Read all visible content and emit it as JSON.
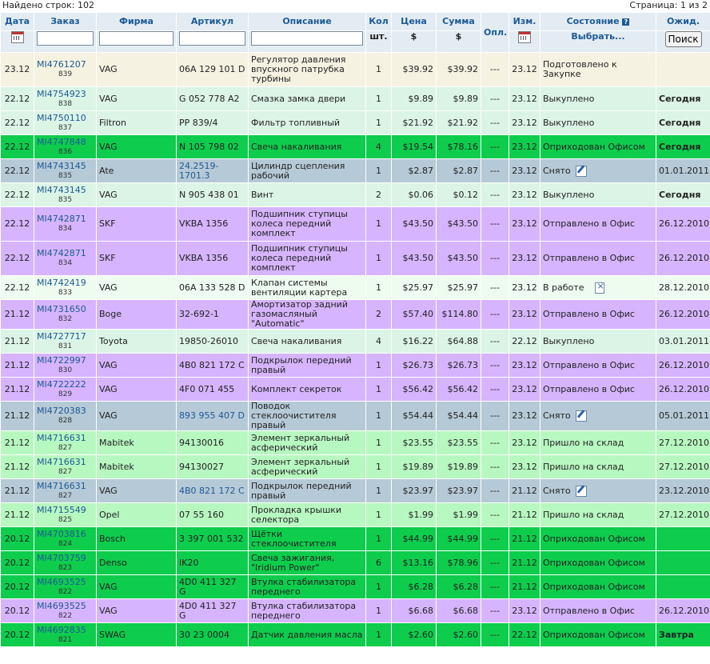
{
  "top": {
    "found": "Найдено строк: 102",
    "page": "Страница: 1 из 2"
  },
  "headers": {
    "date": "Дата",
    "order": "Заказ",
    "firm": "Фирма",
    "article": "Артикул",
    "desc": "Описание",
    "qty": "Кол",
    "qty_unit": "шт.",
    "price": "Цена",
    "price_unit": "$",
    "sum": "Сумма",
    "sum_unit": "$",
    "paid": "Опл.",
    "changed": "Изм.",
    "state": "Состояние",
    "state_select": "Выбрать...",
    "expected": "Ожид.",
    "search_btn": "Поиск"
  },
  "rows": [
    {
      "bg": "cream",
      "tall": true,
      "date": "23.12",
      "order": "MI4761207",
      "num": "839",
      "firm": "VAG",
      "article": "06A 129 101 D",
      "desc": "Регулятор давления впускного патрубка турбины",
      "qty": "1",
      "price": "$39.92",
      "sum": "$39.92",
      "paid": "---",
      "chg": "23.12",
      "state": "Подготовлено к Закупке",
      "icon": "",
      "exp": "",
      "expBold": false
    },
    {
      "bg": "mint",
      "date": "22.12",
      "order": "MI4754923",
      "num": "838",
      "firm": "VAG",
      "article": "G 052 778 A2",
      "desc": "Смазка замка двери",
      "qty": "1",
      "price": "$9.89",
      "sum": "$9.89",
      "paid": "---",
      "chg": "23.12",
      "state": "Выкуплено",
      "icon": "",
      "exp": "Сегодня",
      "expBold": true
    },
    {
      "bg": "mint",
      "date": "22.12",
      "order": "MI4750110",
      "num": "837",
      "firm": "Filtron",
      "article": "PP 839/4",
      "desc": "Фильтр топливный",
      "qty": "1",
      "price": "$21.92",
      "sum": "$21.92",
      "paid": "---",
      "chg": "23.12",
      "state": "Выкуплено",
      "icon": "",
      "exp": "Сегодня",
      "expBold": true
    },
    {
      "bg": "green",
      "date": "22.12",
      "order": "MI4747848",
      "num": "836",
      "firm": "VAG",
      "article": "N 105 798 02",
      "desc": "Свеча накаливания",
      "qty": "4",
      "price": "$19.54",
      "sum": "$78.16",
      "paid": "---",
      "chg": "23.12",
      "state": "Оприходован Офисом",
      "icon": "",
      "exp": "Сегодня",
      "expBold": true
    },
    {
      "bg": "grey",
      "date": "22.12",
      "order": "MI4743145",
      "num": "835",
      "firm": "Ate",
      "article": "24.2519-1701.3",
      "artlink": true,
      "desc": "Цилиндр сцепления рабочий",
      "qty": "1",
      "price": "$2.87",
      "sum": "$2.87",
      "paid": "---",
      "chg": "23.12",
      "state": "Снято",
      "icon": "edit",
      "exp": "01.01.2011",
      "expBold": false
    },
    {
      "bg": "mint",
      "date": "22.12",
      "order": "MI4743145",
      "num": "835",
      "firm": "VAG",
      "article": "N 905 438 01",
      "desc": "Винт",
      "qty": "2",
      "price": "$0.06",
      "sum": "$0.12",
      "paid": "---",
      "chg": "23.12",
      "state": "Выкуплено",
      "icon": "",
      "exp": "Сегодня",
      "expBold": true
    },
    {
      "bg": "purple",
      "tall": true,
      "date": "22.12",
      "order": "MI4742871",
      "num": "834",
      "firm": "SKF",
      "article": "VKBA 1356",
      "desc": "Подшипник ступицы колеса передний комплект",
      "qty": "1",
      "price": "$43.50",
      "sum": "$43.50",
      "paid": "---",
      "chg": "23.12",
      "state": "Отправлено в Офис",
      "icon": "",
      "exp": "26.12.2010",
      "expBold": false
    },
    {
      "bg": "purple",
      "tall": true,
      "date": "22.12",
      "order": "MI4742871",
      "num": "834",
      "firm": "SKF",
      "article": "VKBA 1356",
      "desc": "Подшипник ступицы колеса передний комплект",
      "qty": "1",
      "price": "$43.50",
      "sum": "$43.50",
      "paid": "---",
      "chg": "23.12",
      "state": "Отправлено в Офис",
      "icon": "",
      "exp": "26.12.2010",
      "expBold": false
    },
    {
      "bg": "light",
      "date": "22.12",
      "order": "MI4742419",
      "num": "833",
      "firm": "VAG",
      "article": "06A 133 528 D",
      "desc": "Клапан системы вентиляции картера",
      "qty": "1",
      "price": "$25.97",
      "sum": "$25.97",
      "paid": "---",
      "chg": "23.12",
      "state": "В работе",
      "icon": "del",
      "exp": "28.12.2010",
      "expBold": false
    },
    {
      "bg": "purple",
      "date": "21.12",
      "order": "MI4731650",
      "num": "832",
      "firm": "Boge",
      "article": "32-692-1",
      "desc": "Амортизатор задний газомасляный \"Automatic\"",
      "qty": "2",
      "price": "$57.40",
      "sum": "$114.80",
      "paid": "---",
      "chg": "23.12",
      "state": "Отправлено в Офис",
      "icon": "",
      "exp": "26.12.2010",
      "expBold": false
    },
    {
      "bg": "mint",
      "date": "21.12",
      "order": "MI4727717",
      "num": "831",
      "firm": "Toyota",
      "article": "19850-26010",
      "desc": "Свеча накаливания",
      "qty": "4",
      "price": "$16.22",
      "sum": "$64.88",
      "paid": "---",
      "chg": "22.12",
      "state": "Выкуплено",
      "icon": "",
      "exp": "03.01.2011",
      "expBold": false
    },
    {
      "bg": "purple",
      "date": "21.12",
      "order": "MI4722997",
      "num": "830",
      "firm": "VAG",
      "article": "4B0 821 172 C",
      "desc": "Подкрылок передний правый",
      "qty": "1",
      "price": "$26.73",
      "sum": "$26.73",
      "paid": "---",
      "chg": "23.12",
      "state": "Отправлено в Офис",
      "icon": "",
      "exp": "26.12.2010",
      "expBold": false
    },
    {
      "bg": "purple",
      "date": "21.12",
      "order": "MI4722222",
      "num": "829",
      "firm": "VAG",
      "article": "4F0 071 455",
      "desc": "Комплект секреток",
      "qty": "1",
      "price": "$56.42",
      "sum": "$56.42",
      "paid": "---",
      "chg": "23.12",
      "state": "Отправлено в Офис",
      "icon": "",
      "exp": "26.12.2010",
      "expBold": false
    },
    {
      "bg": "grey",
      "date": "21.12",
      "order": "MI4720383",
      "num": "828",
      "firm": "VAG",
      "article": "893 955 407 D",
      "artlink": true,
      "desc": "Поводок стеклоочистителя правый",
      "qty": "1",
      "price": "$54.44",
      "sum": "$54.44",
      "paid": "---",
      "chg": "23.12",
      "state": "Снято",
      "icon": "edit",
      "exp": "05.01.2011",
      "expBold": false
    },
    {
      "bg": "lightgreen",
      "date": "21.12",
      "order": "MI4716631",
      "num": "827",
      "firm": "Mabitek",
      "article": "94130016",
      "desc": "Элемент зеркальный асферический",
      "qty": "1",
      "price": "$23.55",
      "sum": "$23.55",
      "paid": "---",
      "chg": "23.12",
      "state": "Пришло на склад",
      "icon": "",
      "exp": "27.12.2010",
      "expBold": false
    },
    {
      "bg": "lightgreen",
      "date": "21.12",
      "order": "MI4716631",
      "num": "827",
      "firm": "Mabitek",
      "article": "94130027",
      "desc": "Элемент зеркальный асферический",
      "qty": "1",
      "price": "$19.89",
      "sum": "$19.89",
      "paid": "---",
      "chg": "23.12",
      "state": "Пришло на склад",
      "icon": "",
      "exp": "27.12.2010",
      "expBold": false
    },
    {
      "bg": "grey",
      "date": "21.12",
      "order": "MI4716631",
      "num": "827",
      "firm": "VAG",
      "article": "4B0 821 172 C",
      "artlink": true,
      "desc": "Подкрылок передний правый",
      "qty": "1",
      "price": "$23.97",
      "sum": "$23.97",
      "paid": "---",
      "chg": "21.12",
      "state": "Снято",
      "icon": "edit",
      "exp": "23.12.2010",
      "expBold": false
    },
    {
      "bg": "lightgreen",
      "date": "21.12",
      "order": "MI4715549",
      "num": "825",
      "firm": "Opel",
      "article": "07 55 160",
      "desc": "Прокладка крышки селектора",
      "qty": "1",
      "price": "$1.99",
      "sum": "$1.99",
      "paid": "---",
      "chg": "21.12",
      "state": "Пришло на склад",
      "icon": "",
      "exp": "27.12.2010",
      "expBold": false
    },
    {
      "bg": "green",
      "date": "20.12",
      "order": "MI4703816",
      "num": "824",
      "firm": "Bosch",
      "article": "3 397 001 532",
      "desc": "Щётки стеклоочистителя",
      "qty": "1",
      "price": "$44.99",
      "sum": "$44.99",
      "paid": "---",
      "chg": "21.12",
      "state": "Оприходован Офисом",
      "icon": "",
      "exp": "",
      "expBold": false
    },
    {
      "bg": "green",
      "date": "20.12",
      "order": "MI4703759",
      "num": "823",
      "firm": "Denso",
      "article": "IK20",
      "desc": "Свеча зажигания, \"Iridium Power\"",
      "qty": "6",
      "price": "$13.16",
      "sum": "$78.96",
      "paid": "---",
      "chg": "21.12",
      "state": "Оприходован Офисом",
      "icon": "",
      "exp": "",
      "expBold": false
    },
    {
      "bg": "green",
      "date": "20.12",
      "order": "MI4693525",
      "num": "822",
      "firm": "VAG",
      "article": "4D0 411 327 G",
      "desc": "Втулка стабилизатора переднего",
      "qty": "1",
      "price": "$6.28",
      "sum": "$6.28",
      "paid": "---",
      "chg": "21.12",
      "state": "Оприходован Офисом",
      "icon": "",
      "exp": "",
      "expBold": false
    },
    {
      "bg": "purple",
      "date": "20.12",
      "order": "MI4693525",
      "num": "822",
      "firm": "VAG",
      "article": "4D0 411 327 G",
      "desc": "Втулка стабилизатора переднего",
      "qty": "1",
      "price": "$6.68",
      "sum": "$6.68",
      "paid": "---",
      "chg": "23.12",
      "state": "Отправлено в Офис",
      "icon": "",
      "exp": "26.12.2010",
      "expBold": false
    },
    {
      "bg": "green",
      "date": "20.12",
      "order": "MI4692835",
      "num": "821",
      "firm": "SWAG",
      "article": "30 23 0004",
      "desc": "Датчик давления масла",
      "qty": "1",
      "price": "$2.60",
      "sum": "$2.60",
      "paid": "---",
      "chg": "22.12",
      "state": "Оприходован Офисом",
      "icon": "",
      "exp": "Завтра",
      "expBold": true
    }
  ]
}
